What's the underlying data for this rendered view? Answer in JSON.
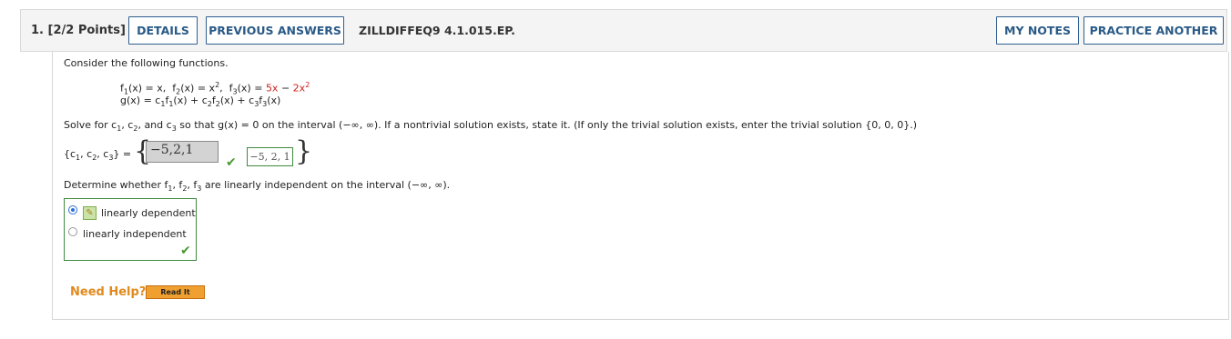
{
  "header": {
    "question_label": "1.  [2/2 Points]",
    "details_label": "DETAILS",
    "previous_answers_label": "PREVIOUS ANSWERS",
    "question_id": "ZILLDIFFEQ9 4.1.015.EP.",
    "my_notes_label": "MY NOTES",
    "practice_another_label": "PRACTICE ANOTHER"
  },
  "question": {
    "intro": "Consider the following functions.",
    "f1_def": "(x) = x,",
    "f2_def": "(x) = x",
    "f3_def": "(x) = ",
    "f3_a": "5x",
    "f3_op": " − ",
    "f3_b": "2x",
    "g_def": "g(x) = c",
    "solve_prompt": "so that g(x) = 0 on the interval (−∞, ∞). If a nontrivial solution exists, state it. (If only the trivial solution exists, enter the trivial solution {0, 0, 0}.)",
    "set_label_pre": "{c",
    "entered_answer": "−5,2,1",
    "correct_answer": "−5, 2, 1",
    "determine_prompt": "are linearly independent on the interval (−∞, ∞).",
    "options": [
      "linearly dependent",
      "linearly independent"
    ],
    "selected_option": 0
  },
  "help": {
    "need_help_label": "Need Help?",
    "read_it_label": "Read It"
  },
  "colors": {
    "accent": "#2a5a86",
    "correct": "#3f8a3f",
    "help": "#e08a1e"
  }
}
